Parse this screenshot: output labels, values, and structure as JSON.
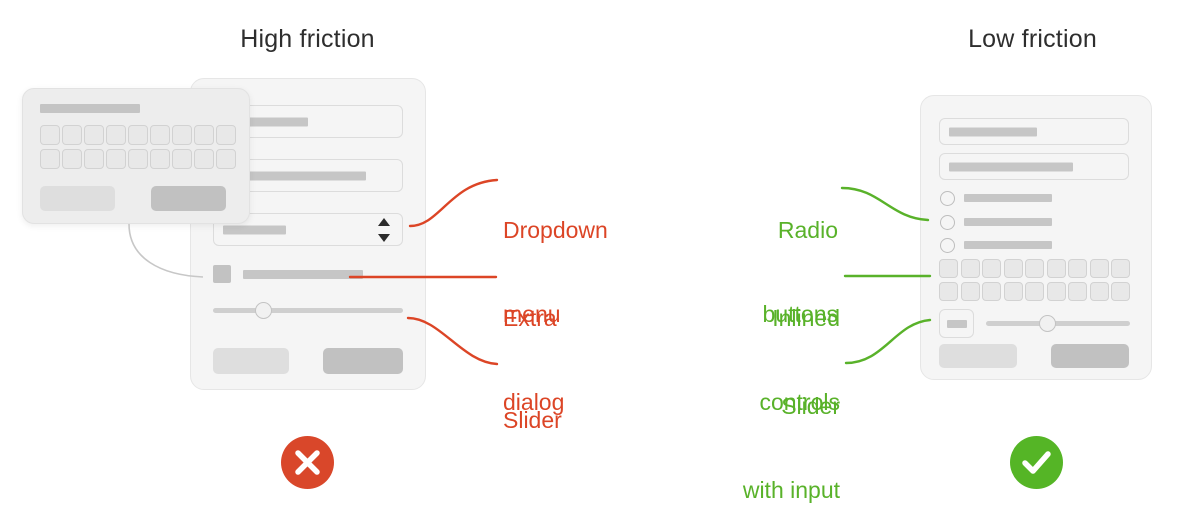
{
  "headings": {
    "left": "High friction",
    "right": "Low friction"
  },
  "colors": {
    "red": "#dc4526",
    "green": "#59b22a",
    "card_bg": "#f5f5f5",
    "card_border": "#e6e6e6",
    "overlay_bg": "#ededed",
    "placeholder_gray": "#c6c6c6",
    "control_gray": "#d2d2d2",
    "button_light": "#dedede",
    "button_dark": "#c1c1c1",
    "verdict_bad": "#d9472a",
    "verdict_good": "#55b526",
    "heading_text": "#2e2e2e"
  },
  "annotations": {
    "red": [
      {
        "id": "dropdown-menu",
        "lines": [
          "Dropdown",
          "menu"
        ],
        "text": "Dropdown menu"
      },
      {
        "id": "extra-dialog",
        "lines": [
          "Extra",
          "dialog"
        ],
        "text": "Extra dialog"
      },
      {
        "id": "slider",
        "lines": [
          "Slider"
        ],
        "text": "Slider"
      }
    ],
    "green": [
      {
        "id": "radio-buttons",
        "lines": [
          "Radio",
          "buttons"
        ],
        "text": "Radio buttons"
      },
      {
        "id": "inlined-controls",
        "lines": [
          "Inlined",
          "controls"
        ],
        "text": "Inlined controls"
      },
      {
        "id": "slider-with-input",
        "lines": [
          "Slider",
          "with input"
        ],
        "text": "Slider with input"
      }
    ]
  },
  "left_panel": {
    "name": "High friction dialog",
    "overlay_dialog": {
      "title_bar": "",
      "keypad_rows": 2,
      "keypad_cols": 9,
      "buttons": [
        "",
        ""
      ]
    },
    "controls": [
      {
        "type": "text-input",
        "fill_ratio": 0.45
      },
      {
        "type": "text-input",
        "fill_ratio": 0.75
      },
      {
        "type": "dropdown",
        "fill_ratio": 0.33,
        "stepper": "up-down-arrows"
      },
      {
        "type": "checkbox",
        "label_width": 120
      },
      {
        "type": "slider",
        "value_ratio": 0.26
      }
    ],
    "buttons": [
      {
        "style": "light",
        "label": ""
      },
      {
        "style": "dark",
        "label": ""
      }
    ]
  },
  "right_panel": {
    "name": "Low friction dialog",
    "controls": [
      {
        "type": "text-input",
        "fill_ratio": 0.47
      },
      {
        "type": "text-input",
        "fill_ratio": 0.66
      },
      {
        "type": "radio-group",
        "options": 3
      },
      {
        "type": "keypad",
        "rows": 2,
        "cols": 9
      },
      {
        "type": "slider-with-input",
        "value_ratio": 0.37
      }
    ],
    "buttons": [
      {
        "style": "light",
        "label": ""
      },
      {
        "style": "dark",
        "label": ""
      }
    ]
  },
  "verdicts": {
    "left": {
      "icon": "cross-icon",
      "meaning": "bad"
    },
    "right": {
      "icon": "check-icon",
      "meaning": "good"
    }
  }
}
